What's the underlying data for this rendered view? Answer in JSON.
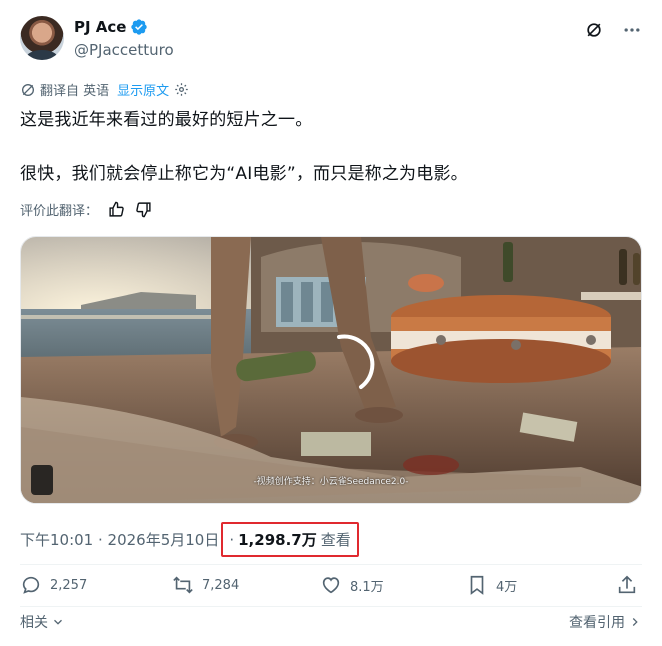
{
  "author": {
    "name": "PJ Ace",
    "handle": "@PJaccetturo",
    "verified": true
  },
  "header_icons": [
    "grok-icon",
    "more-icon"
  ],
  "translation": {
    "label": "翻译自 英语",
    "show_original": "显示原文"
  },
  "tweet": {
    "line1": "这是我近年来看过的最好的短片之一。",
    "line2": "很快，我们就会停止称它为“AI电影”，而只是称之为电影。"
  },
  "rate_translation": "评价此翻译：",
  "media": {
    "caption": "-视频创作支持：小云雀Seedance2.0-"
  },
  "meta": {
    "timestamp": "下午10:01 · 2026年5月10日",
    "separator": "·",
    "views_count": "1,298.7万",
    "views_label": "查看"
  },
  "actions": {
    "replies": "2,257",
    "reposts": "7,284",
    "likes": "8.1万",
    "bookmarks": "4万"
  },
  "footer": {
    "related": "相关",
    "view_quotes": "查看引用"
  },
  "colors": {
    "accent": "#1d9bf0",
    "highlight_box": "#e0292f"
  }
}
